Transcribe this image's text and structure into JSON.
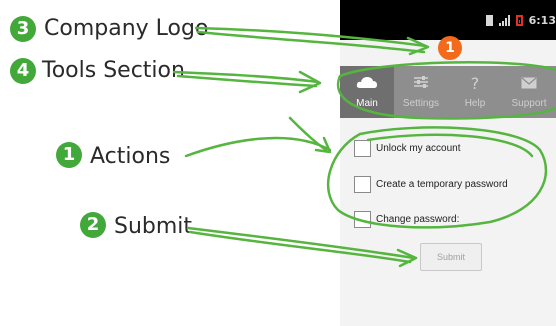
{
  "annotations": [
    {
      "number": "3",
      "label": "Company Logo"
    },
    {
      "number": "4",
      "label": "Tools Section"
    },
    {
      "number": "1",
      "label": "Actions"
    },
    {
      "number": "2",
      "label": "Submit"
    }
  ],
  "colors": {
    "annotation_badge": "#43a83a",
    "annotation_line": "#55b53f",
    "logo_marker": "#f26a1b",
    "battery_icon": "#e0302a"
  },
  "phone": {
    "status_bar": {
      "time": "6:13",
      "icons": [
        "sim-icon",
        "signal-icon",
        "battery-icon"
      ]
    },
    "logo_marker": "1",
    "toolbar": [
      {
        "label": "Main",
        "icon": "cloud-icon",
        "active": true
      },
      {
        "label": "Settings",
        "icon": "sliders-icon",
        "active": false
      },
      {
        "label": "Help",
        "icon": "question-icon",
        "active": false
      },
      {
        "label": "Support",
        "icon": "envelope-icon",
        "active": false
      }
    ],
    "options": [
      {
        "label": "Unlock my account",
        "checked": false
      },
      {
        "label": "Create a temporary password",
        "checked": false
      },
      {
        "label": "Change password:",
        "checked": false
      }
    ],
    "submit_label": "Submit"
  }
}
